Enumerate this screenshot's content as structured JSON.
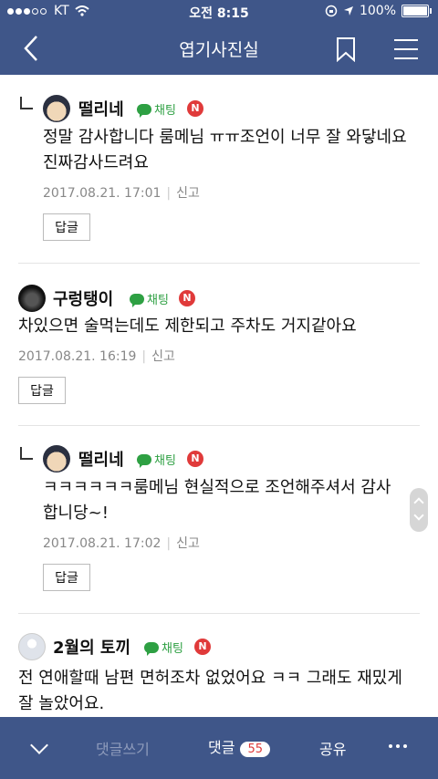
{
  "status": {
    "carrier": "KT",
    "time": "오전 8:15",
    "battery": "100%"
  },
  "nav": {
    "title": "엽기사진실"
  },
  "comments": [
    {
      "author": "떨리네",
      "chat_label": "채팅",
      "badge": "N",
      "text": "정말 감사합니다 룸메님 ㅠㅠ조언이 너무 잘 와닿네요 진짜감사드려요",
      "date": "2017.08.21. 17:01",
      "report": "신고",
      "reply_label": "답글"
    },
    {
      "author": "구렁탱이",
      "chat_label": "채팅",
      "badge": "N",
      "text": "차있으면 술먹는데도 제한되고 주차도 거지같아요",
      "date": "2017.08.21. 16:19",
      "report": "신고",
      "reply_label": "답글"
    },
    {
      "author": "떨리네",
      "chat_label": "채팅",
      "badge": "N",
      "text": "ㅋㅋㅋㅋㅋㅋ룸메님 현실적으로 조언해주셔서 감사합니당~!",
      "date": "2017.08.21. 17:02",
      "report": "신고",
      "reply_label": "답글"
    },
    {
      "author": "2월의 토끼",
      "chat_label": "채팅",
      "badge": "N",
      "text": "전 연애할때 남편 면허조차 없었어요 ㅋㅋ 그래도 재밌게 잘 놀았어요."
    }
  ],
  "bottom": {
    "write_label": "댓글쓰기",
    "comments_label": "댓글",
    "comments_count": "55",
    "share_label": "공유"
  },
  "colors": {
    "bar": "#3f5689",
    "chat": "#2ea043",
    "badge": "#e03a3a"
  }
}
